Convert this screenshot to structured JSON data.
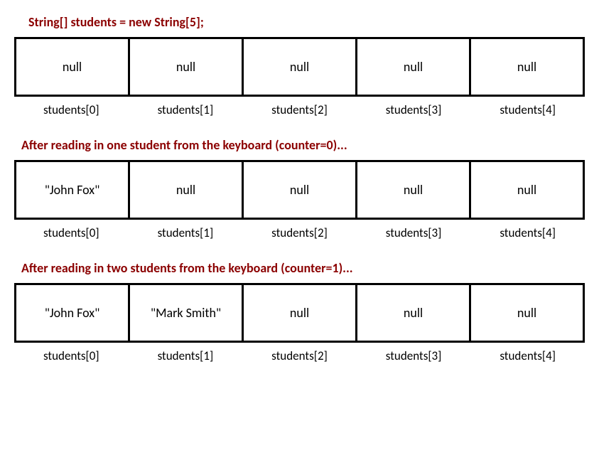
{
  "sections": [
    {
      "heading": "String[] students = new String[5];",
      "cells": [
        "null",
        "null",
        "null",
        "null",
        "null"
      ],
      "labels": [
        "students[0]",
        "students[1]",
        "students[2]",
        "students[3]",
        "students[4]"
      ]
    },
    {
      "heading": "After reading in one student from the keyboard (counter=0)...",
      "cells": [
        "\"John Fox\"",
        "null",
        "null",
        "null",
        "null"
      ],
      "labels": [
        "students[0]",
        "students[1]",
        "students[2]",
        "students[3]",
        "students[4]"
      ]
    },
    {
      "heading": "After reading in two students from the keyboard (counter=1)...",
      "cells": [
        "\"John Fox\"",
        "\"Mark Smith\"",
        "null",
        "null",
        "null"
      ],
      "labels": [
        "students[0]",
        "students[1]",
        "students[2]",
        "students[3]",
        "students[4]"
      ]
    }
  ]
}
